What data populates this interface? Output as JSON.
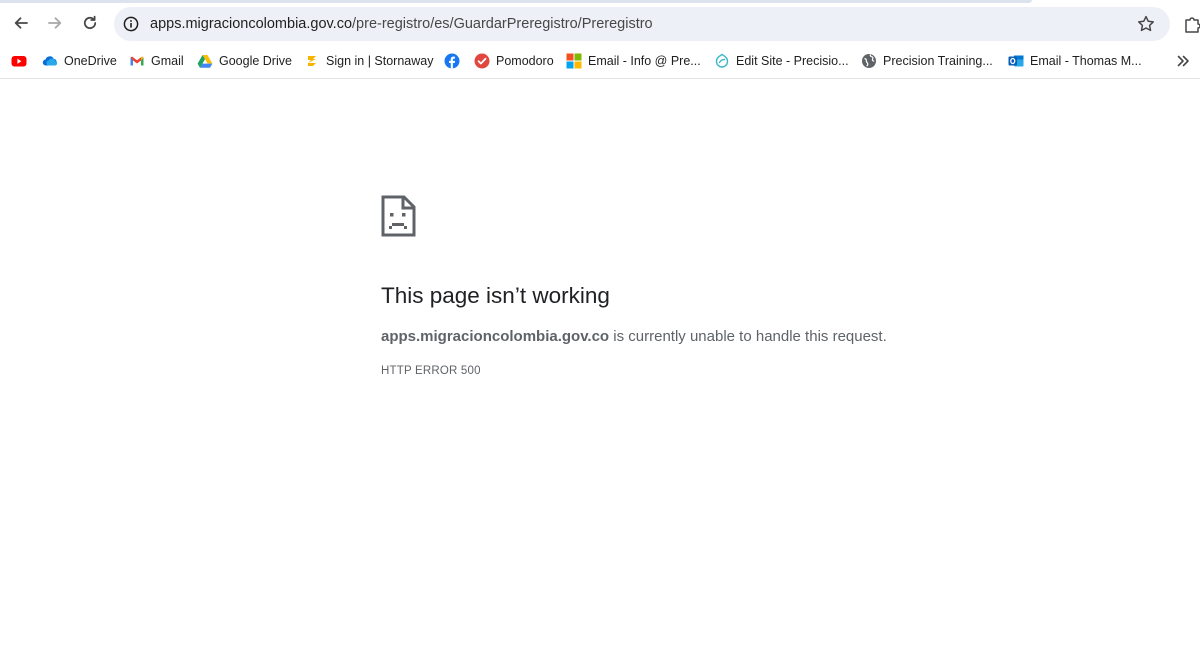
{
  "browser": {
    "url_host": "apps.migracioncolombia.gov.co",
    "url_path": "/pre-registro/es/GuardarPreregistro/Preregistro"
  },
  "bookmarks": [
    {
      "label": "",
      "icon": "youtube-icon"
    },
    {
      "label": "OneDrive",
      "icon": "onedrive-icon"
    },
    {
      "label": "Gmail",
      "icon": "gmail-icon"
    },
    {
      "label": "Google Drive",
      "icon": "google-drive-icon"
    },
    {
      "label": "Sign in | Stornaway",
      "icon": "stornaway-icon"
    },
    {
      "label": "",
      "icon": "facebook-icon"
    },
    {
      "label": "Pomodoro",
      "icon": "pomodoro-icon"
    },
    {
      "label": "Email - Info @ Pre...",
      "icon": "microsoft-icon"
    },
    {
      "label": "Edit Site - Precisio...",
      "icon": "site-editor-icon"
    },
    {
      "label": "Precision Training...",
      "icon": "globe-icon"
    },
    {
      "label": "Email - Thomas M...",
      "icon": "outlook-icon"
    }
  ],
  "error_page": {
    "title": "This page isn’t working",
    "host": "apps.migracioncolombia.gov.co",
    "message": " is currently unable to handle this request.",
    "code": "HTTP ERROR 500"
  },
  "colors": {
    "omnibox_bg": "#edf1f7",
    "title_text": "#202124",
    "body_text": "#5f6368"
  }
}
